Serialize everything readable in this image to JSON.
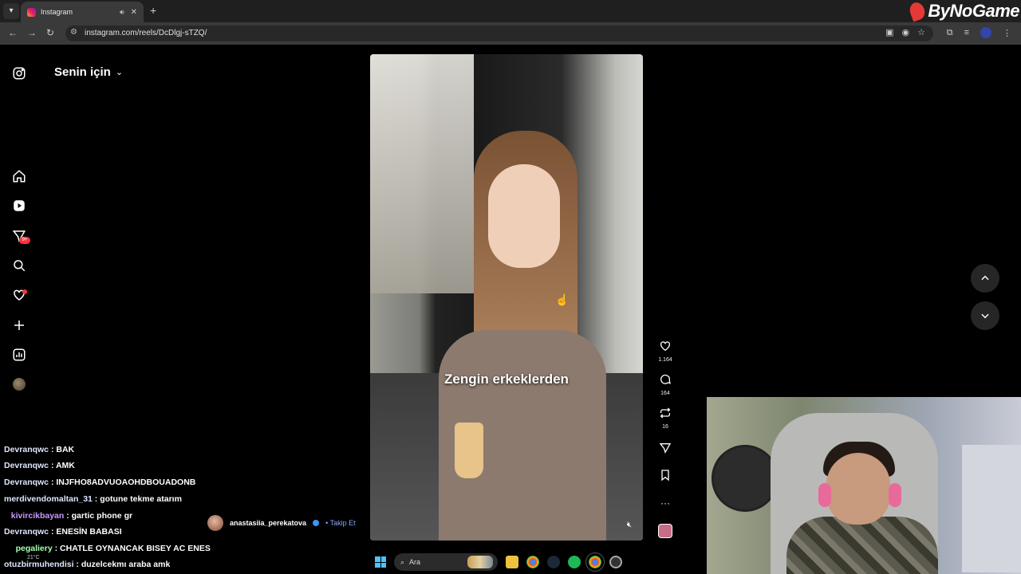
{
  "browser": {
    "tab_title": "Instagram",
    "url": "instagram.com/reels/DcDlgj-sTZQ/",
    "overlay_logo": "ByNoGame"
  },
  "instagram": {
    "feed_label": "Senin için",
    "notifications_badge": "9+",
    "reel": {
      "caption": "Zengin erkeklerden",
      "author": "anastasiia_perekatova",
      "follow_label": "Takip Et",
      "likes": "1.164",
      "comments": "164",
      "reposts": "16"
    }
  },
  "chat": [
    {
      "user": "Devranqwc",
      "text": " : BAK",
      "cls": "u"
    },
    {
      "user": "Devranqwc",
      "text": " : AMK",
      "cls": "u"
    },
    {
      "user": "Devranqwc",
      "text": " : INJFHO8ADVUOAOHDBOUADONB",
      "cls": "u"
    },
    {
      "user": "merdivendomaltan_31",
      "text": " : gotune tekme atarım",
      "cls": "u"
    },
    {
      "user": "kivircikbayan",
      "text": " : gartic phone gr",
      "cls": "u2"
    },
    {
      "user": "Devranqwc",
      "text": " : ENESİN BABASI",
      "cls": "u"
    },
    {
      "user": "pegaliery",
      "text": " : CHATLE OYNANCAK BISEY AC ENES",
      "cls": "u3"
    },
    {
      "user": "otuzbirmuhendisi",
      "text": " : duzelcekmı araba amk",
      "cls": "u"
    }
  ],
  "taskbar": {
    "search_placeholder": "Ara",
    "temperature": "21°C"
  },
  "colors": {
    "accent_red": "#ff3040",
    "verified_blue": "#3897f0"
  }
}
